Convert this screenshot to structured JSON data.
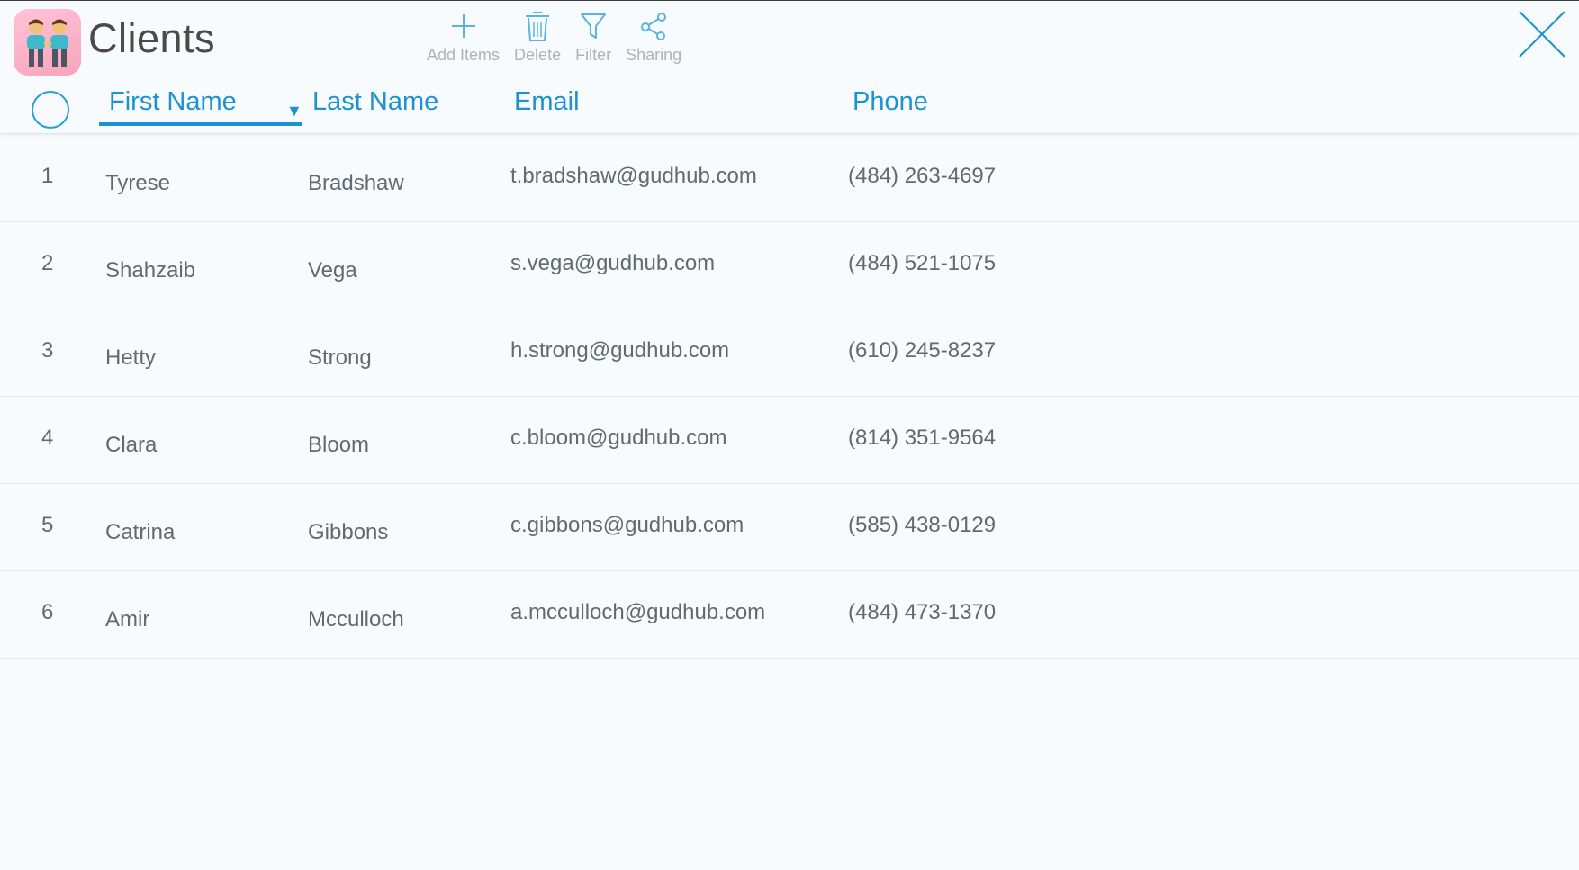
{
  "app": {
    "title": "Clients",
    "icon": "two-people-icon"
  },
  "toolbar": {
    "add_label": "Add Items",
    "delete_label": "Delete",
    "filter_label": "Filter",
    "sharing_label": "Sharing"
  },
  "columns": {
    "first_name": "First Name",
    "last_name": "Last Name",
    "email": "Email",
    "phone": "Phone",
    "sorted_by": "First Name",
    "sort_direction": "descending"
  },
  "rows": [
    {
      "num": "1",
      "first": "Tyrese",
      "last": "Bradshaw",
      "email": "t.bradshaw@gudhub.com",
      "phone": "(484) 263-4697"
    },
    {
      "num": "2",
      "first": "Shahzaib",
      "last": "Vega",
      "email": "s.vega@gudhub.com",
      "phone": "(484) 521-1075"
    },
    {
      "num": "3",
      "first": "Hetty",
      "last": "Strong",
      "email": "h.strong@gudhub.com",
      "phone": "(610) 245-8237"
    },
    {
      "num": "4",
      "first": "Clara",
      "last": "Bloom",
      "email": "c.bloom@gudhub.com",
      "phone": "(814) 351-9564"
    },
    {
      "num": "5",
      "first": "Catrina",
      "last": "Gibbons",
      "email": "c.gibbons@gudhub.com",
      "phone": "(585) 438-0129"
    },
    {
      "num": "6",
      "first": "Amir",
      "last": "Mcculloch",
      "email": "a.mcculloch@gudhub.com",
      "phone": "(484) 473-1370"
    }
  ],
  "colors": {
    "accent": "#1c93d0",
    "text": "#5f6a72",
    "toolbar_label": "#a9b4bc",
    "icon_bg": "#f7a4bc"
  }
}
